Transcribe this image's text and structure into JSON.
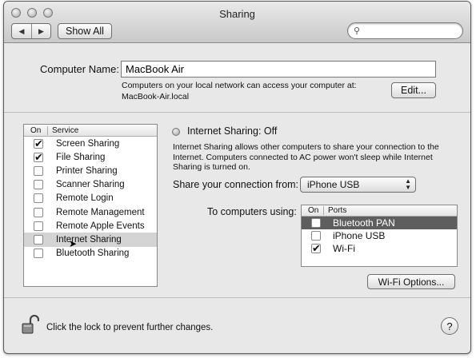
{
  "window": {
    "title": "Sharing"
  },
  "toolbar": {
    "back_icon": "back-arrow-icon",
    "forward_icon": "forward-arrow-icon",
    "back_glyph": "◀",
    "forward_glyph": "▶",
    "show_all_label": "Show All",
    "search_placeholder": "",
    "search_glyph": "🔍"
  },
  "computer_name": {
    "label": "Computer Name:",
    "value": "MacBook Air",
    "info_line1": "Computers on your local network can access your computer at:",
    "info_line2": "MacBook-Air.local",
    "edit_label": "Edit..."
  },
  "services": {
    "header_on": "On",
    "header_service": "Service",
    "items": [
      {
        "name": "Screen Sharing",
        "on": "✔"
      },
      {
        "name": "File Sharing",
        "on": "✔"
      },
      {
        "name": "Printer Sharing",
        "on": ""
      },
      {
        "name": "Scanner Sharing",
        "on": ""
      },
      {
        "name": "Remote Login",
        "on": ""
      },
      {
        "name": "Remote Management",
        "on": ""
      },
      {
        "name": "Remote Apple Events",
        "on": ""
      },
      {
        "name": "Internet Sharing",
        "on": ""
      },
      {
        "name": "Bluetooth Sharing",
        "on": ""
      }
    ],
    "selected_index": 7
  },
  "detail": {
    "status": "Internet Sharing: Off",
    "description": "Internet Sharing allows other computers to share your connection to the Internet. Computers connected to AC power won't sleep while Internet Sharing is turned on.",
    "share_from_label": "Share your connection from:",
    "share_from_value": "iPhone USB",
    "to_computers_label": "To computers using:",
    "ports_header_on": "On",
    "ports_header_ports": "Ports",
    "ports": [
      {
        "name": "Bluetooth PAN",
        "on": ""
      },
      {
        "name": "iPhone USB",
        "on": ""
      },
      {
        "name": "Wi-Fi",
        "on": "✔"
      }
    ],
    "selected_port_index": 0,
    "wifi_options_label": "Wi-Fi Options..."
  },
  "footer": {
    "lock_text": "Click the lock to prevent further changes.",
    "help_label": "?"
  }
}
